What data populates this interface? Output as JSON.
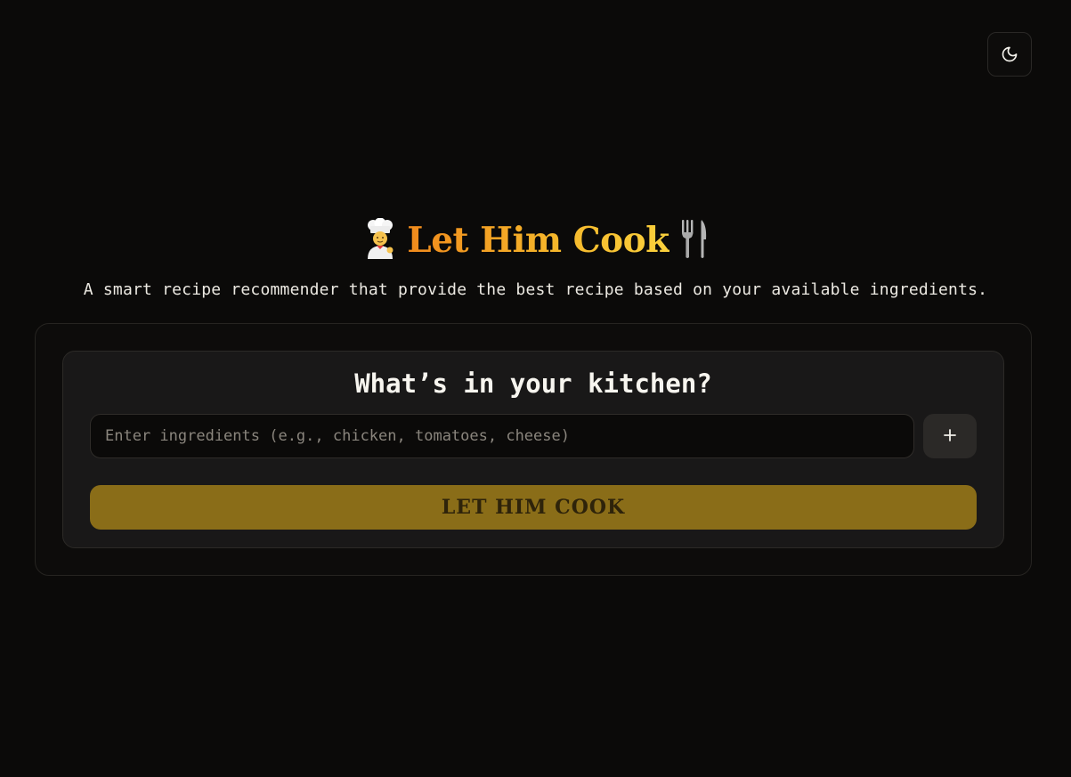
{
  "header": {
    "theme_toggle": {
      "icon": "moon-icon"
    }
  },
  "hero": {
    "chef_icon": "chef-emoji-icon",
    "title": "Let Him Cook",
    "utensils_icon": "fork-knife-icon",
    "subtitle": "A smart recipe recommender that provide the best recipe based on your available ingredients."
  },
  "form": {
    "heading": "What’s in your kitchen?",
    "input": {
      "value": "",
      "placeholder": "Enter ingredients (e.g., chicken, tomatoes, cheese)"
    },
    "add_button": {
      "icon": "plus-icon"
    },
    "submit_label": "LET HIM COOK"
  },
  "colors": {
    "background": "#0b0a09",
    "card": "#191818",
    "accent_gradient_start": "#f08a1c",
    "accent_gradient_end": "#fbd13c",
    "submit_button": "#8a6d18"
  }
}
